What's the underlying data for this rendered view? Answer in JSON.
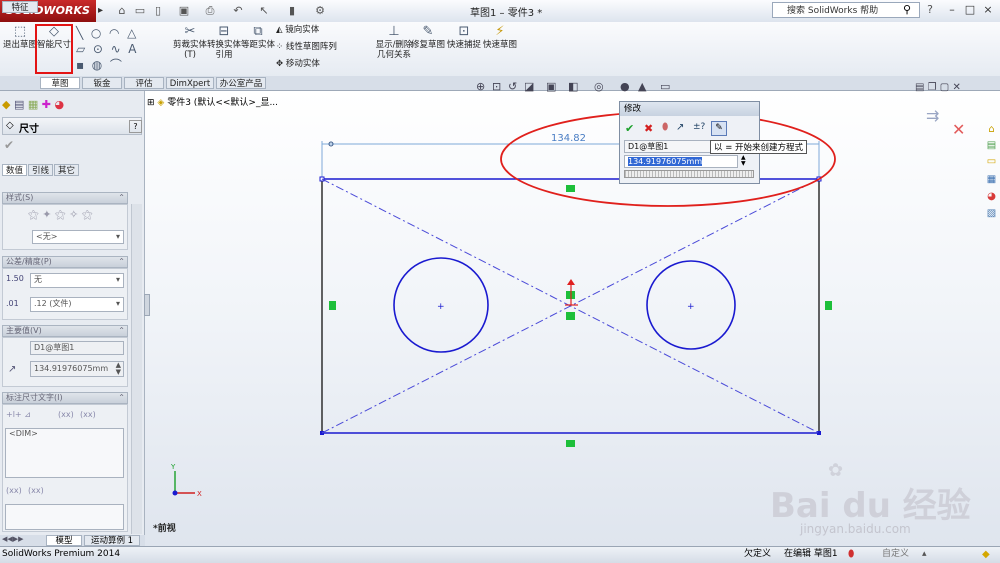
{
  "app": {
    "logo": "SOLIDWORKS",
    "doc_title": "草图1 – 零件3 *",
    "help_search": "搜索 SolidWorks 帮助",
    "window_buttons": [
      "–",
      "□",
      "×"
    ],
    "quick_access_icons": [
      "home-icon",
      "new-icon",
      "open-icon",
      "save-icon",
      "print-icon",
      "undo-icon",
      "select-icon",
      "rebuild-icon",
      "options-icon"
    ]
  },
  "commands": {
    "exit_sketch": "退出草图",
    "smart_dimension": "智能尺寸",
    "trim": "剪裁实体(T)",
    "convert": "转换实体引用",
    "offset": "等距实体",
    "mirror": "镜向实体",
    "linear_pattern": "线性草图阵列",
    "move": "移动实体",
    "show_delete": "显示/删除几何关系",
    "repair": "修复草图",
    "snaps": "快速捕捉",
    "rapid_sketch": "快速草图",
    "highlight_color": "#e31414"
  },
  "tabs": [
    "特征",
    "草图",
    "钣金",
    "评估",
    "DimXpert",
    "办公室产品"
  ],
  "active_tab": "草图",
  "feature_tree": {
    "part": "零件3 (默认<<默认>_显..."
  },
  "panel": {
    "title": "尺寸",
    "help": "?",
    "tabs": [
      "数值",
      "引线",
      "其它"
    ],
    "style": {
      "label": "样式(S)",
      "value": "<无>"
    },
    "tolerance": {
      "label": "公差/精度(P)",
      "tol_value": "无",
      "precision_value": ".12 (文件)"
    },
    "primary_value": {
      "label": "主要值(V)",
      "name": "D1@草图1",
      "value": "134.91976075mm"
    },
    "dim_text": {
      "label": "标注尺寸文字(I)",
      "placeholder": "<DIM>",
      "tags1": [
        "(xx)",
        "(xx)"
      ],
      "tags2": [
        "(xx)",
        "(xx)"
      ]
    }
  },
  "modify_dialog": {
    "title": "修改",
    "name": "D1@草图1",
    "value": "134.91976075mm",
    "tooltip": "以 = 开始来创建方程式"
  },
  "sketch": {
    "dimension_label": "134.82",
    "view_label": "*前视"
  },
  "bottom_tabs": [
    "模型",
    "运动算例 1"
  ],
  "status": {
    "product": "SolidWorks Premium 2014",
    "state": "欠定义",
    "editing": "在编辑 草图1",
    "custom": "自定义"
  },
  "watermark": {
    "brand": "Bai du 经验",
    "url": "jingyan.baidu.com"
  },
  "colors": {
    "sketch_line": "#1a1ad0",
    "annotation_ellipse": "#e0201c",
    "relation_marker": "#1dbf3a"
  }
}
